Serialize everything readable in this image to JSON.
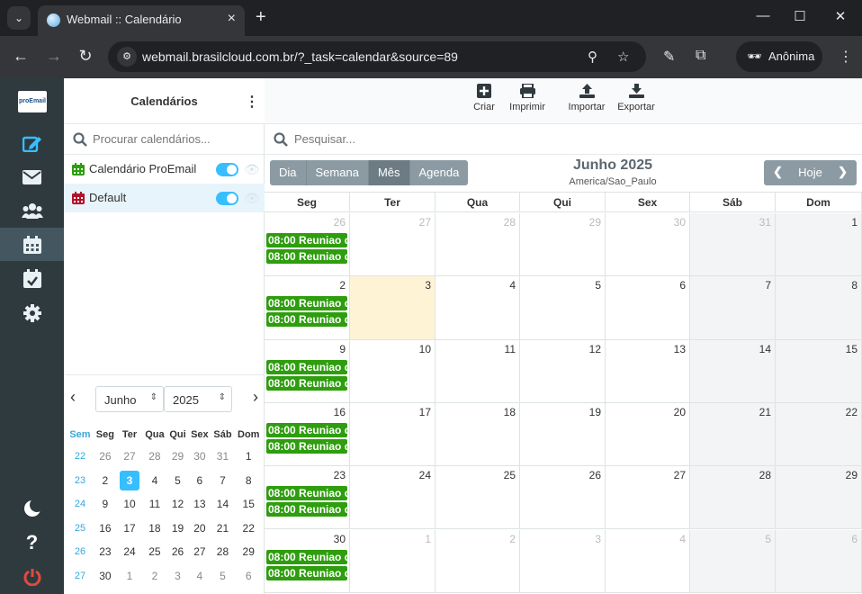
{
  "browser": {
    "tab_title": "Webmail :: Calendário",
    "url": "webmail.brasilcloud.com.br/?_task=calendar&source=89",
    "profile_label": "Anônima"
  },
  "app": {
    "logo_text": "proEmail",
    "rail_icons": [
      "compose-icon",
      "mail-icon",
      "contacts-icon",
      "calendar-icon",
      "tasks-icon",
      "settings-icon",
      "dark-mode-icon",
      "help-icon",
      "logout-icon"
    ]
  },
  "calendars_panel": {
    "title": "Calendários",
    "search_placeholder": "Procurar calendários...",
    "items": [
      {
        "name": "Calendário ProEmail",
        "color": "#2e9d0e"
      },
      {
        "name": "Default",
        "color": "#b0142a"
      }
    ]
  },
  "mini_calendar": {
    "month": "Junho",
    "year": "2025",
    "headers": [
      "Sem",
      "Seg",
      "Ter",
      "Qua",
      "Qui",
      "Sex",
      "Sáb",
      "Dom"
    ],
    "weeks": [
      [
        "22",
        "26",
        "27",
        "28",
        "29",
        "30",
        "31",
        "1"
      ],
      [
        "23",
        "2",
        "3",
        "4",
        "5",
        "6",
        "7",
        "8"
      ],
      [
        "24",
        "9",
        "10",
        "11",
        "12",
        "13",
        "14",
        "15"
      ],
      [
        "25",
        "16",
        "17",
        "18",
        "19",
        "20",
        "21",
        "22"
      ],
      [
        "26",
        "23",
        "24",
        "25",
        "26",
        "27",
        "28",
        "29"
      ],
      [
        "27",
        "30",
        "1",
        "2",
        "3",
        "4",
        "5",
        "6"
      ]
    ],
    "today": "3"
  },
  "toolbar": {
    "create": "Criar",
    "print": "Imprimir",
    "import": "Importar",
    "export": "Exportar"
  },
  "main": {
    "search_placeholder": "Pesquisar...",
    "views": [
      "Dia",
      "Semana",
      "Mês",
      "Agenda"
    ],
    "active_view": "Mês",
    "month_title": "Junho 2025",
    "timezone": "America/Sao_Paulo",
    "today_label": "Hoje",
    "weekdays": [
      "Seg",
      "Ter",
      "Qua",
      "Qui",
      "Sex",
      "Sáb",
      "Dom"
    ],
    "weeks": [
      [
        "26",
        "27",
        "28",
        "29",
        "30",
        "31",
        "1"
      ],
      [
        "2",
        "3",
        "4",
        "5",
        "6",
        "7",
        "8"
      ],
      [
        "9",
        "10",
        "11",
        "12",
        "13",
        "14",
        "15"
      ],
      [
        "16",
        "17",
        "18",
        "19",
        "20",
        "21",
        "22"
      ],
      [
        "23",
        "24",
        "25",
        "26",
        "27",
        "28",
        "29"
      ],
      [
        "30",
        "1",
        "2",
        "3",
        "4",
        "5",
        "6"
      ]
    ],
    "event_label": "08:00 Reuniao d",
    "event_color": "#2e9d0e",
    "today_color": "#fff3d6"
  }
}
